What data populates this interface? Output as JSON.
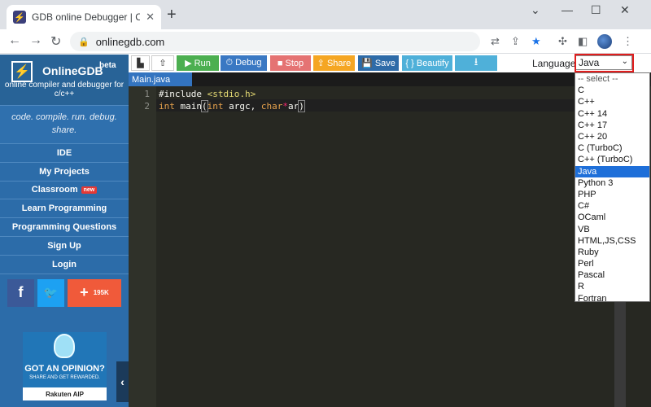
{
  "browser": {
    "tab_title": "GDB online Debugger | Compile",
    "tab_favicon_symbol": "⚡",
    "url": "onlinegdb.com"
  },
  "sidebar": {
    "logo_name": "OnlineGDB",
    "logo_beta": "beta",
    "tagline": "online compiler and debugger for c/c++",
    "slogan": "code. compile. run. debug. share.",
    "menu": [
      {
        "label": "IDE"
      },
      {
        "label": "My Projects"
      },
      {
        "label": "Classroom",
        "badge": "new"
      },
      {
        "label": "Learn Programming"
      },
      {
        "label": "Programming Questions"
      },
      {
        "label": "Sign Up"
      },
      {
        "label": "Login"
      }
    ],
    "social": {
      "facebook": "f",
      "twitter": "🐦",
      "share_plus": "+",
      "share_count": "195K"
    },
    "ad": {
      "headline": "GOT AN OPINION?",
      "subline": "SHARE AND GET REWARDED.",
      "brand": "Rakuten AIP"
    }
  },
  "actionbar": {
    "run": "▶ Run",
    "debug": "⏱ Debug",
    "stop": "■ Stop",
    "share": "⇪ Share",
    "save": "💾 Save",
    "beautify": "{ } Beautify",
    "download": "⭳",
    "language_label": "Language",
    "language_value": "Java",
    "colors": {
      "run": "#4caf50",
      "debug": "#3a78c3",
      "stop": "#e57373",
      "share": "#f5a623",
      "save": "#2e6ba8",
      "beautify": "#4fb0d9",
      "download": "#4fb0d9"
    }
  },
  "editor": {
    "file_tab": "Main.java",
    "lines": [
      {
        "no": "1",
        "text": "#include <stdio.h>"
      },
      {
        "no": "2",
        "text": "int main(int argc, char*ar)"
      }
    ]
  },
  "dropdown": {
    "options": [
      "-- select --",
      "C",
      "C++",
      "C++ 14",
      "C++ 17",
      "C++ 20",
      "C (TurboC)",
      "C++ (TurboC)",
      "Java",
      "Python 3",
      "PHP",
      "C#",
      "OCaml",
      "VB",
      "HTML,JS,CSS",
      "Ruby",
      "Perl",
      "Pascal",
      "R",
      "Fortran"
    ],
    "selected": "Java"
  }
}
